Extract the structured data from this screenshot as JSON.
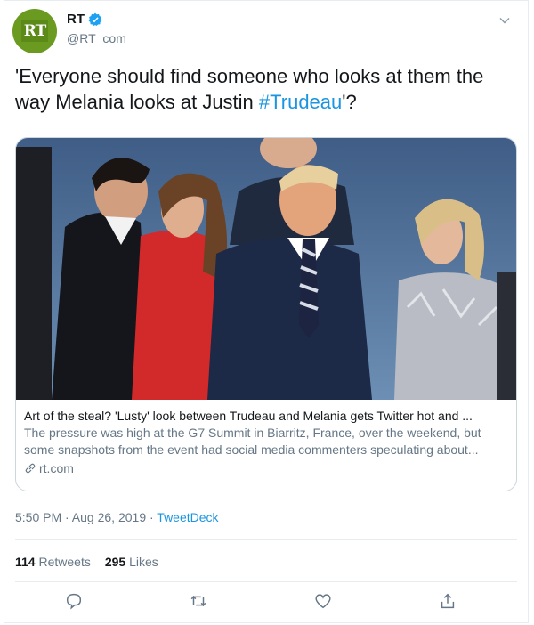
{
  "account": {
    "name": "RT",
    "handle": "@RT_com",
    "avatar_text": "RT"
  },
  "tweet": {
    "text_before": "'Everyone should find someone who looks at them the way Melania looks at Justin ",
    "hashtag": "#Trudeau",
    "text_after": "'?"
  },
  "link_card": {
    "title": "Art of the steal? 'Lusty' look between Trudeau and Melania gets Twitter hot and ...",
    "description": "The pressure was high at the G7 Summit in Biarritz, France, over the weekend, but some snapshots from the event had social media commenters speculating about...",
    "domain": "rt.com"
  },
  "meta": {
    "time": "5:50 PM · Aug 26, 2019 · ",
    "source": "TweetDeck"
  },
  "stats": {
    "retweets_count": "114",
    "retweets_label": "Retweets",
    "likes_count": "295",
    "likes_label": "Likes"
  },
  "icons": {
    "reply": "comment-icon",
    "retweet": "retweet-icon",
    "like": "heart-icon",
    "share": "share-icon"
  },
  "colors": {
    "link": "#1b95e0",
    "avatar_green": "#6a9a1f",
    "secondary_text": "#657786"
  }
}
